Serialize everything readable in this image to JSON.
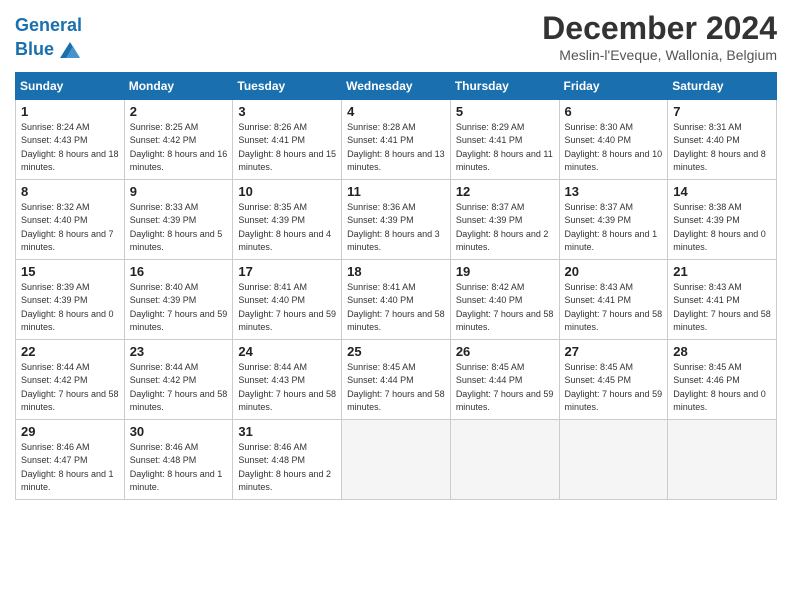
{
  "header": {
    "logo_line1": "General",
    "logo_line2": "Blue",
    "month_title": "December 2024",
    "location": "Meslin-l'Eveque, Wallonia, Belgium"
  },
  "days_of_week": [
    "Sunday",
    "Monday",
    "Tuesday",
    "Wednesday",
    "Thursday",
    "Friday",
    "Saturday"
  ],
  "weeks": [
    [
      {
        "day": "1",
        "sunrise": "8:24 AM",
        "sunset": "4:43 PM",
        "daylight": "8 hours and 18 minutes."
      },
      {
        "day": "2",
        "sunrise": "8:25 AM",
        "sunset": "4:42 PM",
        "daylight": "8 hours and 16 minutes."
      },
      {
        "day": "3",
        "sunrise": "8:26 AM",
        "sunset": "4:41 PM",
        "daylight": "8 hours and 15 minutes."
      },
      {
        "day": "4",
        "sunrise": "8:28 AM",
        "sunset": "4:41 PM",
        "daylight": "8 hours and 13 minutes."
      },
      {
        "day": "5",
        "sunrise": "8:29 AM",
        "sunset": "4:41 PM",
        "daylight": "8 hours and 11 minutes."
      },
      {
        "day": "6",
        "sunrise": "8:30 AM",
        "sunset": "4:40 PM",
        "daylight": "8 hours and 10 minutes."
      },
      {
        "day": "7",
        "sunrise": "8:31 AM",
        "sunset": "4:40 PM",
        "daylight": "8 hours and 8 minutes."
      }
    ],
    [
      {
        "day": "8",
        "sunrise": "8:32 AM",
        "sunset": "4:40 PM",
        "daylight": "8 hours and 7 minutes."
      },
      {
        "day": "9",
        "sunrise": "8:33 AM",
        "sunset": "4:39 PM",
        "daylight": "8 hours and 5 minutes."
      },
      {
        "day": "10",
        "sunrise": "8:35 AM",
        "sunset": "4:39 PM",
        "daylight": "8 hours and 4 minutes."
      },
      {
        "day": "11",
        "sunrise": "8:36 AM",
        "sunset": "4:39 PM",
        "daylight": "8 hours and 3 minutes."
      },
      {
        "day": "12",
        "sunrise": "8:37 AM",
        "sunset": "4:39 PM",
        "daylight": "8 hours and 2 minutes."
      },
      {
        "day": "13",
        "sunrise": "8:37 AM",
        "sunset": "4:39 PM",
        "daylight": "8 hours and 1 minute."
      },
      {
        "day": "14",
        "sunrise": "8:38 AM",
        "sunset": "4:39 PM",
        "daylight": "8 hours and 0 minutes."
      }
    ],
    [
      {
        "day": "15",
        "sunrise": "8:39 AM",
        "sunset": "4:39 PM",
        "daylight": "8 hours and 0 minutes."
      },
      {
        "day": "16",
        "sunrise": "8:40 AM",
        "sunset": "4:39 PM",
        "daylight": "7 hours and 59 minutes."
      },
      {
        "day": "17",
        "sunrise": "8:41 AM",
        "sunset": "4:40 PM",
        "daylight": "7 hours and 59 minutes."
      },
      {
        "day": "18",
        "sunrise": "8:41 AM",
        "sunset": "4:40 PM",
        "daylight": "7 hours and 58 minutes."
      },
      {
        "day": "19",
        "sunrise": "8:42 AM",
        "sunset": "4:40 PM",
        "daylight": "7 hours and 58 minutes."
      },
      {
        "day": "20",
        "sunrise": "8:43 AM",
        "sunset": "4:41 PM",
        "daylight": "7 hours and 58 minutes."
      },
      {
        "day": "21",
        "sunrise": "8:43 AM",
        "sunset": "4:41 PM",
        "daylight": "7 hours and 58 minutes."
      }
    ],
    [
      {
        "day": "22",
        "sunrise": "8:44 AM",
        "sunset": "4:42 PM",
        "daylight": "7 hours and 58 minutes."
      },
      {
        "day": "23",
        "sunrise": "8:44 AM",
        "sunset": "4:42 PM",
        "daylight": "7 hours and 58 minutes."
      },
      {
        "day": "24",
        "sunrise": "8:44 AM",
        "sunset": "4:43 PM",
        "daylight": "7 hours and 58 minutes."
      },
      {
        "day": "25",
        "sunrise": "8:45 AM",
        "sunset": "4:44 PM",
        "daylight": "7 hours and 58 minutes."
      },
      {
        "day": "26",
        "sunrise": "8:45 AM",
        "sunset": "4:44 PM",
        "daylight": "7 hours and 59 minutes."
      },
      {
        "day": "27",
        "sunrise": "8:45 AM",
        "sunset": "4:45 PM",
        "daylight": "7 hours and 59 minutes."
      },
      {
        "day": "28",
        "sunrise": "8:45 AM",
        "sunset": "4:46 PM",
        "daylight": "8 hours and 0 minutes."
      }
    ],
    [
      {
        "day": "29",
        "sunrise": "8:46 AM",
        "sunset": "4:47 PM",
        "daylight": "8 hours and 1 minute."
      },
      {
        "day": "30",
        "sunrise": "8:46 AM",
        "sunset": "4:48 PM",
        "daylight": "8 hours and 1 minute."
      },
      {
        "day": "31",
        "sunrise": "8:46 AM",
        "sunset": "4:48 PM",
        "daylight": "8 hours and 2 minutes."
      },
      null,
      null,
      null,
      null
    ]
  ]
}
